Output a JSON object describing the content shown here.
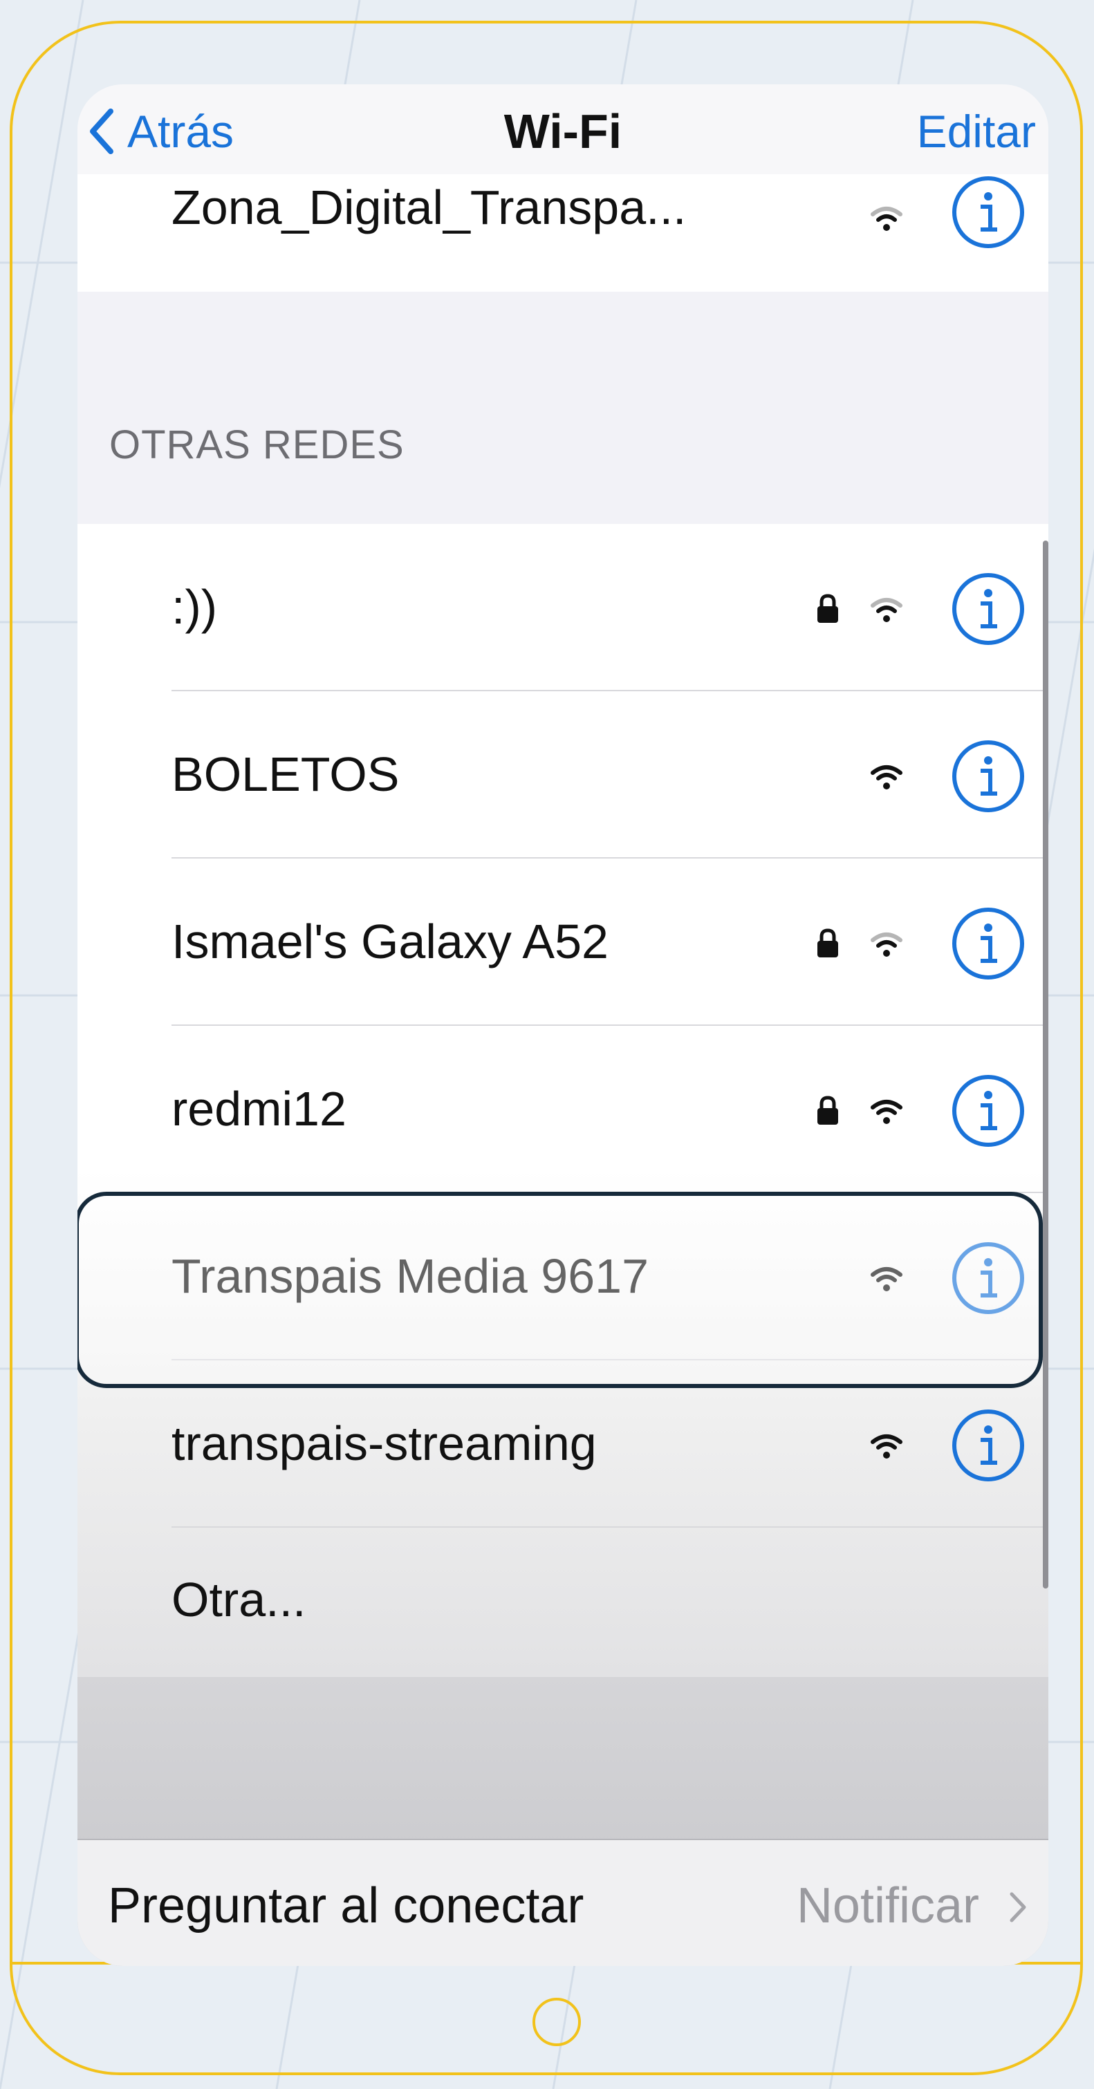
{
  "navbar": {
    "back_label": "Atrás",
    "title": "Wi-Fi",
    "edit_label": "Editar"
  },
  "current_network": {
    "name": "Zona_Digital_Transpa..."
  },
  "section_header": "OTRAS REDES",
  "networks": [
    {
      "name": ":))",
      "secured": true,
      "signal": "weak"
    },
    {
      "name": "BOLETOS",
      "secured": false,
      "signal": "strong"
    },
    {
      "name": "Ismael's Galaxy A52",
      "secured": true,
      "signal": "weak"
    },
    {
      "name": "redmi12",
      "secured": true,
      "signal": "strong"
    },
    {
      "name": "Transpais Media 9617",
      "secured": false,
      "signal": "strong",
      "highlighted": true
    },
    {
      "name": "transpais-streaming",
      "secured": false,
      "signal": "strong"
    },
    {
      "name": "Otra...",
      "secured": false,
      "signal": "none"
    }
  ],
  "footer": {
    "label": "Preguntar al conectar",
    "value": "Notificar"
  },
  "colors": {
    "accent": "#1a73d9",
    "frame": "#f2c21b",
    "highlight_border": "#162a3b"
  },
  "icons": [
    "chevron-left-icon",
    "wifi-icon",
    "lock-icon",
    "info-icon",
    "chevron-right-icon",
    "home-button"
  ]
}
